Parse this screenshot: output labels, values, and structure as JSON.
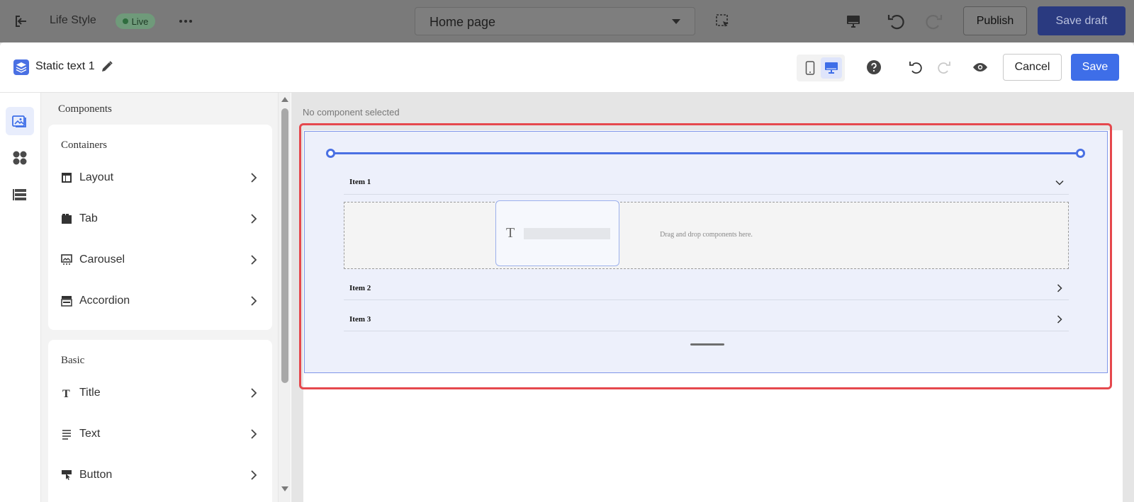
{
  "topbar": {
    "store_name": "Life Style",
    "live_badge": "Live",
    "page_select": "Home page",
    "publish_label": "Publish",
    "save_draft_label": "Save draft"
  },
  "editor": {
    "component_name": "Static text 1",
    "cancel_label": "Cancel",
    "save_label": "Save",
    "active_device": "desktop"
  },
  "panel": {
    "title": "Components",
    "sections": [
      {
        "title": "Containers",
        "items": [
          {
            "label": "Layout",
            "icon": "layout-icon"
          },
          {
            "label": "Tab",
            "icon": "tab-icon"
          },
          {
            "label": "Carousel",
            "icon": "carousel-icon"
          },
          {
            "label": "Accordion",
            "icon": "accordion-icon"
          }
        ]
      },
      {
        "title": "Basic",
        "items": [
          {
            "label": "Title",
            "icon": "title-icon"
          },
          {
            "label": "Text",
            "icon": "text-icon"
          },
          {
            "label": "Button",
            "icon": "button-icon"
          }
        ]
      }
    ]
  },
  "canvas": {
    "status": "No component selected",
    "accordion": {
      "items": [
        "Item 1",
        "Item 2",
        "Item 3"
      ],
      "dropzone_text": "Drag and drop components here."
    },
    "drag_ghost_glyph": "T"
  },
  "colors": {
    "primary": "#3e6ee8",
    "highlight": "#e5484d",
    "live": "#2f6d3e"
  }
}
